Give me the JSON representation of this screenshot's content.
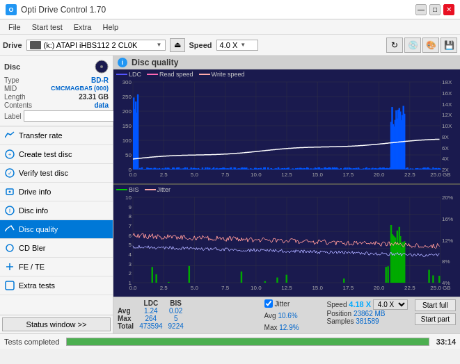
{
  "titleBar": {
    "icon": "O",
    "title": "Opti Drive Control 1.70",
    "minimize": "—",
    "maximize": "□",
    "close": "✕"
  },
  "menuBar": {
    "items": [
      "File",
      "Start test",
      "Extra",
      "Help"
    ]
  },
  "driveBar": {
    "label": "Drive",
    "driveName": "(k:) ATAPI iHBS112  2 CL0K",
    "speedLabel": "Speed",
    "speedValue": "4.0 X"
  },
  "disc": {
    "label": "Disc",
    "type_key": "Type",
    "type_val": "BD-R",
    "mid_key": "MID",
    "mid_val": "CMCMAGBA5 (000)",
    "length_key": "Length",
    "length_val": "23.31 GB",
    "contents_key": "Contents",
    "contents_val": "data",
    "label_key": "Label",
    "label_placeholder": ""
  },
  "sidebarItems": [
    {
      "id": "transfer-rate",
      "label": "Transfer rate",
      "active": false
    },
    {
      "id": "create-test-disc",
      "label": "Create test disc",
      "active": false
    },
    {
      "id": "verify-test-disc",
      "label": "Verify test disc",
      "active": false
    },
    {
      "id": "drive-info",
      "label": "Drive info",
      "active": false
    },
    {
      "id": "disc-info",
      "label": "Disc info",
      "active": false
    },
    {
      "id": "disc-quality",
      "label": "Disc quality",
      "active": true
    },
    {
      "id": "cd-bler",
      "label": "CD Bler",
      "active": false
    },
    {
      "id": "fe-te",
      "label": "FE / TE",
      "active": false
    },
    {
      "id": "extra-tests",
      "label": "Extra tests",
      "active": false
    }
  ],
  "statusWindow": {
    "buttonLabel": "Status window >>",
    "progressText": "Tests completed",
    "progressPercent": 100,
    "timeLabel": "33:14"
  },
  "discQuality": {
    "title": "Disc quality",
    "topChart": {
      "legend": [
        {
          "label": "LDC",
          "color": "#0000ff"
        },
        {
          "label": "Read speed",
          "color": "#ff69b4"
        },
        {
          "label": "Write speed",
          "color": "#ff69b4"
        }
      ],
      "yLabelsLeft": [
        "300",
        "250",
        "200",
        "150",
        "100",
        "50",
        "0"
      ],
      "yLabelsRight": [
        "18X",
        "16X",
        "14X",
        "12X",
        "10X",
        "8X",
        "6X",
        "4X",
        "2X"
      ],
      "xLabels": [
        "0.0",
        "2.5",
        "5.0",
        "7.5",
        "10.0",
        "12.5",
        "15.0",
        "17.5",
        "20.0",
        "22.5",
        "25.0 GB"
      ]
    },
    "bottomChart": {
      "legend": [
        {
          "label": "BIS",
          "color": "#00ff00"
        },
        {
          "label": "Jitter",
          "color": "#ffaaaa"
        }
      ],
      "yLabelsLeft": [
        "10",
        "9",
        "8",
        "7",
        "6",
        "5",
        "4",
        "3",
        "2",
        "1"
      ],
      "yLabelsRight": [
        "20%",
        "16%",
        "12%",
        "8%",
        "4%"
      ],
      "xLabels": [
        "0.0",
        "2.5",
        "5.0",
        "7.5",
        "10.0",
        "12.5",
        "15.0",
        "17.5",
        "20.0",
        "22.5",
        "25.0 GB"
      ]
    }
  },
  "stats": {
    "headers": [
      "LDC",
      "BIS"
    ],
    "rows": [
      {
        "label": "Avg",
        "ldc": "1.24",
        "bis": "0.02"
      },
      {
        "label": "Max",
        "ldc": "264",
        "bis": "5"
      },
      {
        "label": "Total",
        "ldc": "473594",
        "bis": "9224"
      }
    ],
    "jitter": {
      "checked": true,
      "label": "Jitter",
      "avg": "10.6%",
      "max": "12.9%"
    },
    "speed": {
      "label": "Speed",
      "value": "4.18 X",
      "selectValue": "4.0 X"
    },
    "position": {
      "label": "Position",
      "value": "23862 MB"
    },
    "samples": {
      "label": "Samples",
      "value": "381589"
    },
    "buttons": {
      "startFull": "Start full",
      "startPart": "Start part"
    }
  },
  "bottomBar": {
    "statusText": "Tests completed",
    "progressPercent": 100,
    "time": "33:14"
  }
}
